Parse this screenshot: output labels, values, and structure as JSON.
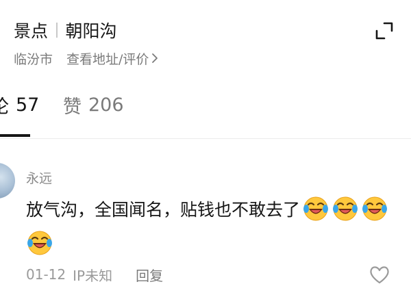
{
  "header": {
    "category": "景点",
    "place_name": "朝阳沟",
    "city": "临汾市",
    "address_link": "查看地址/评价"
  },
  "tabs": [
    {
      "label_fragment": "论",
      "count": "57",
      "active": true
    },
    {
      "label": "赞",
      "count": "206",
      "active": false
    }
  ],
  "comment": {
    "username": "永远",
    "text": "放气沟，全国闻名，贴钱也不敢去了",
    "emojis": [
      "laugh-crying-emoji",
      "laugh-crying-emoji",
      "laugh-crying-emoji",
      "laugh-crying-emoji"
    ],
    "date": "01-12",
    "ip": "IP未知",
    "reply_label": "回复"
  },
  "colors": {
    "text_primary": "#161616",
    "text_secondary": "#7a7a7a",
    "emoji_yellow": "#FFC83D",
    "emoji_tear": "#3AA6E8"
  }
}
